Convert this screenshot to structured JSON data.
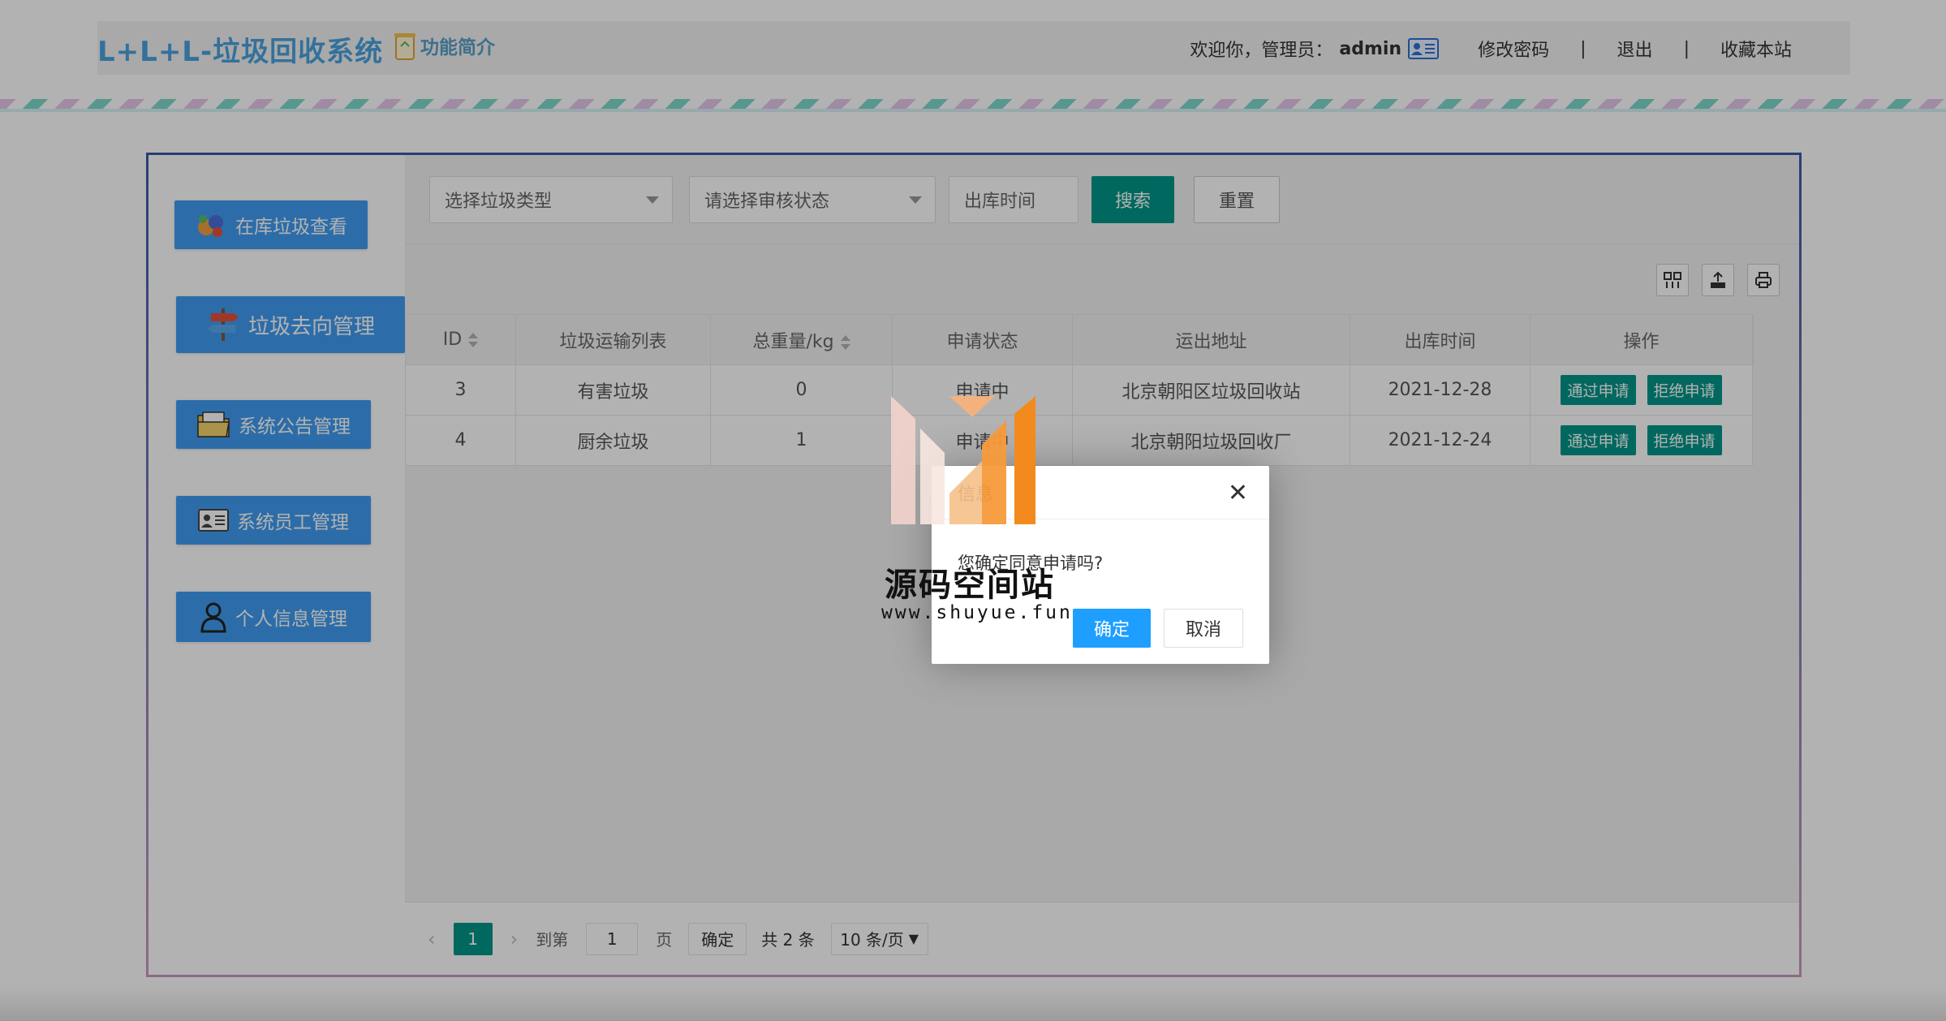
{
  "header": {
    "logo": "L+L+L-垃圾回收系统",
    "intro_label": "功能简介",
    "welcome_prefix": "欢迎你，管理员：",
    "username": "admin",
    "change_password": "修改密码",
    "sep": "|",
    "logout": "退出",
    "bookmark": "收藏本站"
  },
  "sidebar": {
    "items": [
      {
        "label": "在库垃圾查看",
        "icon": "palette-icon"
      },
      {
        "label": "垃圾去向管理",
        "icon": "signpost-icon"
      },
      {
        "label": "系统公告管理",
        "icon": "folder-icon"
      },
      {
        "label": "系统员工管理",
        "icon": "id-card-icon"
      },
      {
        "label": "个人信息管理",
        "icon": "user-icon"
      }
    ]
  },
  "search": {
    "type_placeholder": "选择垃圾类型",
    "status_placeholder": "请选择审核状态",
    "date_placeholder": "出库时间",
    "search_label": "搜索",
    "reset_label": "重置"
  },
  "table": {
    "headers": [
      "ID",
      "垃圾运输列表",
      "总重量/kg",
      "申请状态",
      "运出地址",
      "出库时间",
      "操作"
    ],
    "rows": [
      {
        "id": "3",
        "type": "有害垃圾",
        "weight": "0",
        "status": "申请中",
        "address": "北京朝阳区垃圾回收站",
        "date": "2021-12-28"
      },
      {
        "id": "4",
        "type": "厨余垃圾",
        "weight": "1",
        "status": "申请中",
        "address": "北京朝阳垃圾回收厂",
        "date": "2021-12-24"
      }
    ],
    "approve_label": "通过申请",
    "reject_label": "拒绝申请"
  },
  "pager": {
    "current": "1",
    "goto_label": "到第",
    "goto_value": "1",
    "page_label": "页",
    "confirm_label": "确定",
    "total": "共 2 条",
    "page_size": "10 条/页"
  },
  "dialog": {
    "title": "信息",
    "message": "您确定同意申请吗?",
    "ok": "确定",
    "cancel": "取消"
  },
  "watermark": {
    "name": "源码空间站",
    "url": "www.shuyue.fun"
  },
  "colors": {
    "accent": "#009688",
    "nav": "#3f9df3",
    "link": "#1e9fff"
  }
}
